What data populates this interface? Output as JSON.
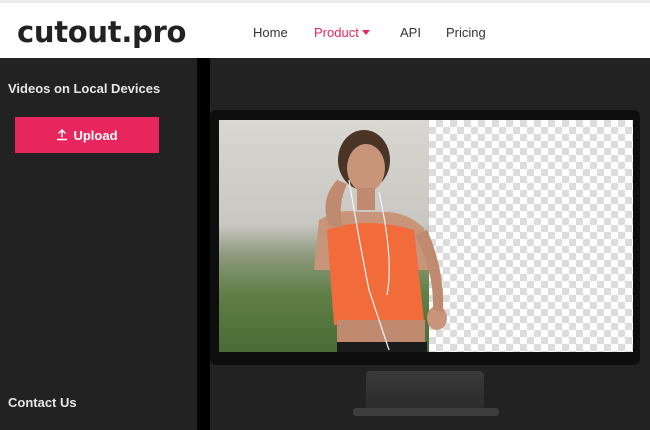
{
  "brand": {
    "logo_text": "cutout.pro",
    "accent_color": "#e8265e"
  },
  "nav": {
    "items": [
      {
        "label": "Home"
      },
      {
        "label": "Product",
        "active": true
      },
      {
        "label": "API"
      },
      {
        "label": "Pricing"
      }
    ]
  },
  "sidebar": {
    "section_title": "Videos on Local Devices",
    "upload_label": "Upload",
    "upload_icon": "upload-arrow-icon",
    "contact_label": "Contact Us"
  },
  "preview": {
    "description_icon": "monitor-icon"
  }
}
